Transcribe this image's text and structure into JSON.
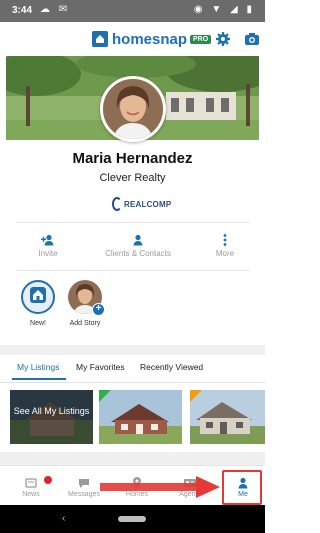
{
  "status_bar": {
    "time": "3:44",
    "left_icons": "☁ ✉",
    "right_icons": "◉ ▼ ◢ ▮"
  },
  "header": {
    "logo_text": "homesnap",
    "logo_badge": "PRO",
    "icons": [
      "gear-icon",
      "camera-icon"
    ]
  },
  "profile": {
    "name": "Maria Hernandez",
    "company": "Clever Realty",
    "partner_logo_text": "REALCOMP"
  },
  "actions": [
    {
      "label": "Invite",
      "icon": "add-person-icon"
    },
    {
      "label": "Clients & Contacts",
      "icon": "person-icon"
    },
    {
      "label": "More",
      "icon": "more-vertical-icon"
    }
  ],
  "stories": [
    {
      "label": "New!",
      "icon": "homesnap-icon"
    },
    {
      "label": "Add Story",
      "icon": "plus-icon"
    }
  ],
  "tabs": [
    {
      "label": "My Listings",
      "active": true
    },
    {
      "label": "My Favorites",
      "active": false
    },
    {
      "label": "Recently Viewed",
      "active": false
    }
  ],
  "listings": {
    "see_all_label": "See All My Listings",
    "flag_colors": [
      "#2bb24c",
      "#f39c12"
    ]
  },
  "bottom_nav": [
    {
      "label": "News",
      "icon": "news-icon",
      "badge": true
    },
    {
      "label": "Messages",
      "icon": "chat-icon"
    },
    {
      "label": "Homes",
      "icon": "location-pin-icon"
    },
    {
      "label": "Agents",
      "icon": "id-card-icon"
    },
    {
      "label": "Me",
      "icon": "person-icon",
      "active": true
    }
  ],
  "colors": {
    "brand": "#1f6fb5",
    "highlight": "#e53935",
    "notification": "#e0242e"
  }
}
